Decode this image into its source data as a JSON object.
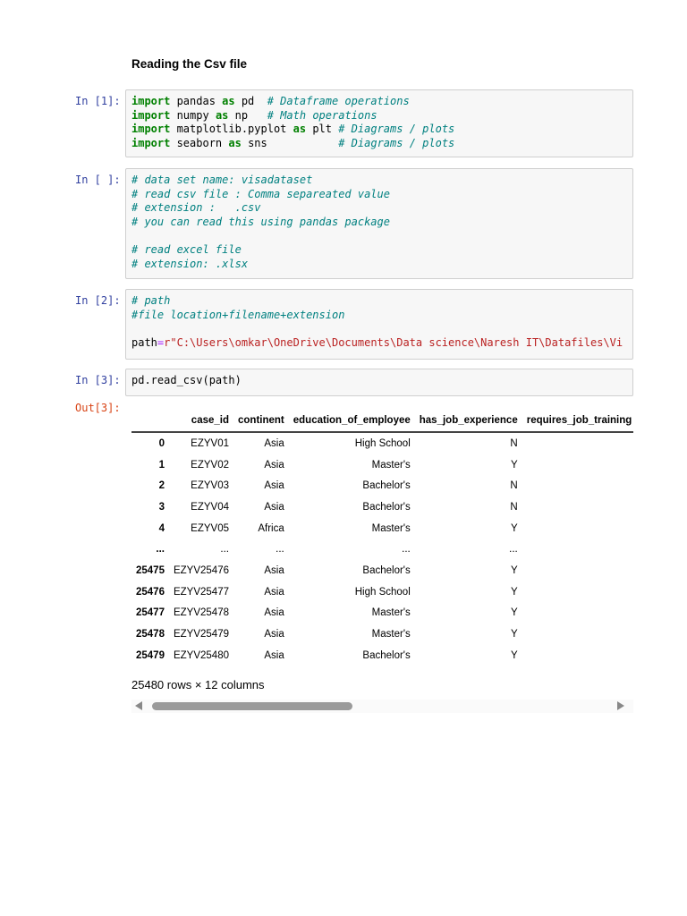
{
  "heading": "Reading the Csv file",
  "cells": [
    {
      "prompt": "In [1]:",
      "lines": [
        [
          {
            "t": "import",
            "c": "kw"
          },
          {
            "t": " pandas "
          },
          {
            "t": "as",
            "c": "kw"
          },
          {
            "t": " pd  "
          },
          {
            "t": "# Dataframe operations",
            "c": "cm"
          }
        ],
        [
          {
            "t": "import",
            "c": "kw"
          },
          {
            "t": " numpy "
          },
          {
            "t": "as",
            "c": "kw"
          },
          {
            "t": " np   "
          },
          {
            "t": "# Math operations",
            "c": "cm"
          }
        ],
        [
          {
            "t": "import",
            "c": "kw"
          },
          {
            "t": " matplotlib.pyplot "
          },
          {
            "t": "as",
            "c": "kw"
          },
          {
            "t": " plt "
          },
          {
            "t": "# Diagrams / plots",
            "c": "cm"
          }
        ],
        [
          {
            "t": "import",
            "c": "kw"
          },
          {
            "t": " seaborn "
          },
          {
            "t": "as",
            "c": "kw"
          },
          {
            "t": " sns           "
          },
          {
            "t": "# Diagrams / plots",
            "c": "cm"
          }
        ]
      ]
    },
    {
      "prompt": "In [ ]:",
      "lines": [
        [
          {
            "t": "# data set name: visadataset",
            "c": "cm"
          }
        ],
        [
          {
            "t": "# read csv file : Comma separeated value",
            "c": "cm"
          }
        ],
        [
          {
            "t": "# extension :   .csv",
            "c": "cm"
          }
        ],
        [
          {
            "t": "# you can read this using pandas package",
            "c": "cm"
          }
        ],
        [
          {
            "t": " "
          }
        ],
        [
          {
            "t": "# read excel file",
            "c": "cm"
          }
        ],
        [
          {
            "t": "# extension: .xlsx",
            "c": "cm"
          }
        ]
      ]
    },
    {
      "prompt": "In [2]:",
      "lines": [
        [
          {
            "t": "# path",
            "c": "cm"
          }
        ],
        [
          {
            "t": "#file location+filename+extension",
            "c": "cm"
          }
        ],
        [
          {
            "t": " "
          }
        ],
        [
          {
            "t": "path"
          },
          {
            "t": "=",
            "c": "op"
          },
          {
            "t": "r\"C:\\Users\\omkar\\OneDrive\\Documents\\Data science\\Naresh IT\\Datafiles\\Vi",
            "c": "st"
          }
        ]
      ]
    },
    {
      "prompt": "In [3]:",
      "lines": [
        [
          {
            "t": "pd.read_csv(path)"
          }
        ]
      ]
    }
  ],
  "output": {
    "prompt": "Out[3]:",
    "columns": [
      "",
      "case_id",
      "continent",
      "education_of_employee",
      "has_job_experience",
      "requires_job_training"
    ],
    "rows": [
      [
        "0",
        "EZYV01",
        "Asia",
        "High School",
        "N"
      ],
      [
        "1",
        "EZYV02",
        "Asia",
        "Master's",
        "Y"
      ],
      [
        "2",
        "EZYV03",
        "Asia",
        "Bachelor's",
        "N"
      ],
      [
        "3",
        "EZYV04",
        "Asia",
        "Bachelor's",
        "N"
      ],
      [
        "4",
        "EZYV05",
        "Africa",
        "Master's",
        "Y"
      ],
      [
        "...",
        "...",
        "...",
        "...",
        "..."
      ],
      [
        "25475",
        "EZYV25476",
        "Asia",
        "Bachelor's",
        "Y"
      ],
      [
        "25476",
        "EZYV25477",
        "Asia",
        "High School",
        "Y"
      ],
      [
        "25477",
        "EZYV25478",
        "Asia",
        "Master's",
        "Y"
      ],
      [
        "25478",
        "EZYV25479",
        "Asia",
        "Master's",
        "Y"
      ],
      [
        "25479",
        "EZYV25480",
        "Asia",
        "Bachelor's",
        "Y"
      ]
    ],
    "shape": "25480 rows × 12 columns",
    "scroll_position_percent": 0
  }
}
